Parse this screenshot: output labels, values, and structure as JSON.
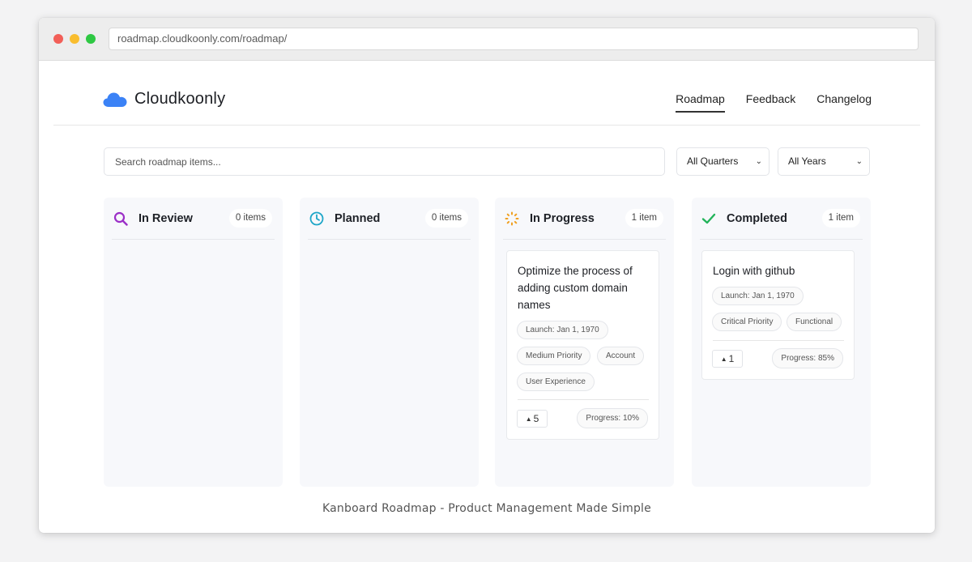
{
  "browser": {
    "url": "roadmap.cloudkoonly.com/roadmap/"
  },
  "header": {
    "brand": "Cloudkoonly",
    "nav": [
      {
        "label": "Roadmap",
        "active": true
      },
      {
        "label": "Feedback",
        "active": false
      },
      {
        "label": "Changelog",
        "active": false
      }
    ]
  },
  "filters": {
    "search_placeholder": "Search roadmap items...",
    "quarter": "All Quarters",
    "year": "All Years"
  },
  "columns": [
    {
      "title": "In Review",
      "count": "0 items",
      "icon": "magnifier-icon",
      "color": "#9b2fc7"
    },
    {
      "title": "Planned",
      "count": "0 items",
      "icon": "clock-icon",
      "color": "#1ea6c8"
    },
    {
      "title": "In Progress",
      "count": "1 item",
      "icon": "spinner-icon",
      "color": "#f0a020"
    },
    {
      "title": "Completed",
      "count": "1 item",
      "icon": "check-icon",
      "color": "#22b35a"
    }
  ],
  "cards": {
    "in_progress": {
      "title": "Optimize the process of adding custom domain names",
      "tags": [
        "Launch: Jan 1, 1970",
        "Medium Priority",
        "Account",
        "User Experience"
      ],
      "votes": "5",
      "progress": "Progress: 10%"
    },
    "completed": {
      "title": "Login with github",
      "tags": [
        "Launch: Jan 1, 1970",
        "Critical Priority",
        "Functional"
      ],
      "votes": "1",
      "progress": "Progress: 85%"
    }
  },
  "footer": "Kanboard Roadmap - Product Management Made Simple",
  "colors": {
    "brand_cloud": "#3b82f6",
    "column_bg": "#f7f8fb"
  }
}
